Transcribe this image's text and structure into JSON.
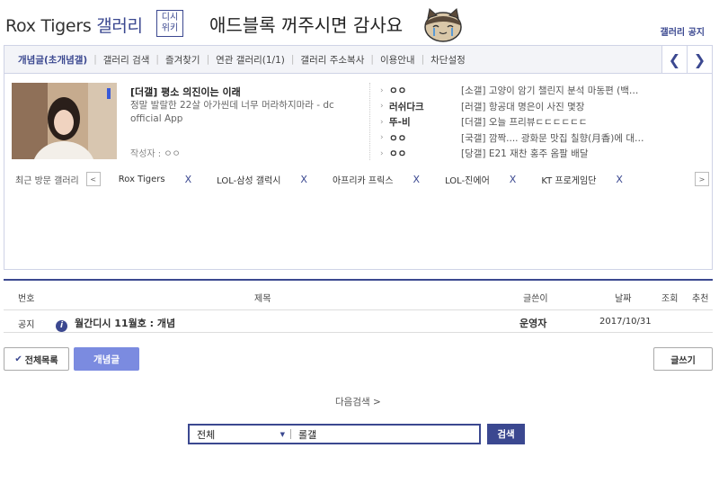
{
  "header": {
    "gallery_name": "Rox Tigers",
    "gallery_suffix": "갤러리",
    "wiki_line1": "디시",
    "wiki_line2": "위키",
    "ad_message": "애드블록 꺼주시면 감사요",
    "notice_link": "갤러리 공지"
  },
  "tabs": [
    {
      "label": "개념글(초개념갤)",
      "active": true
    },
    {
      "label": "갤러리 검색"
    },
    {
      "label": "즐겨찾기"
    },
    {
      "label": "연관 갤러리(1/1)"
    },
    {
      "label": "갤러리 주소복사"
    },
    {
      "label": "이용안내"
    },
    {
      "label": "차단설정"
    }
  ],
  "tab_arrows": {
    "prev": "❮",
    "next": "❯"
  },
  "featured": {
    "title": "[더갤] 평소 의진이는 이래",
    "desc": "정말 발랄한 22살 아가씬데 너무 머라하지마라 - dc official App",
    "author": "작성자 : ㅇㅇ"
  },
  "side_list": [
    {
      "user": "ㅇㅇ",
      "post": "[소갤] 고양이 암기 챌린지 분석 마동편 (백…"
    },
    {
      "user": "러쉬다크",
      "post": "[러갤] 항공대 명은이 사진 몇장"
    },
    {
      "user": "뚜-비",
      "post": "[더갤] 오늘 프리뷰ㄷㄷㄷㄷㄷㄷ"
    },
    {
      "user": "ㅇㅇ",
      "post": "[국갤] 깜짝.... 광화문 맛집 칠향(月香)에 대…"
    },
    {
      "user": "ㅇㅇ",
      "post": "[당갤] E21 재찬 홍주 옴팔 배달"
    }
  ],
  "recent": {
    "label": "최근 방문 갤러리",
    "prev": "<",
    "next": ">",
    "items": [
      "Rox Tigers",
      "LOL-삼성 갤럭시",
      "아프리카 프릭스",
      "LOL-진에어",
      "KT 프로게임단"
    ],
    "remove_glyph": "X"
  },
  "list": {
    "headers": {
      "num": "번호",
      "title": "제목",
      "writer": "글쓴이",
      "date": "날짜",
      "views": "조회",
      "recommend": "추천"
    },
    "rows": [
      {
        "num": "공지",
        "title": "월간디시 11월호 : 개념",
        "writer": "운영자",
        "date": "2017/10/31",
        "views": "",
        "recommend": ""
      }
    ]
  },
  "buttons": {
    "all_list": "전체목록",
    "concept": "개념글",
    "write": "글쓰기"
  },
  "daum_search": "다음검색 >",
  "search": {
    "scope": "전체",
    "value": "롤갤",
    "button": "검색"
  },
  "colors": {
    "accent": "#3b4890",
    "concept_button": "#7b8be0"
  }
}
